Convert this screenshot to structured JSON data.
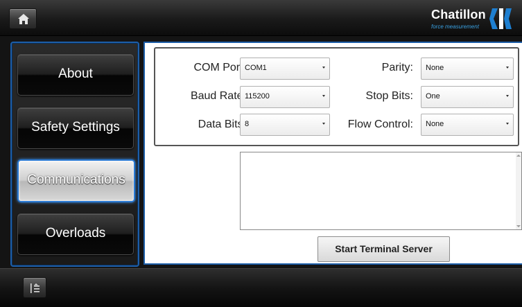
{
  "brand": {
    "name": "Chatillon",
    "tagline": "force measurement"
  },
  "icons": {
    "home": "home-icon",
    "menu": "list-toggle-icon",
    "logo": "chatillon-logo-mark"
  },
  "sidebar": {
    "items": [
      {
        "label": "About",
        "active": false
      },
      {
        "label": "Safety Settings",
        "active": false
      },
      {
        "label": "Communications",
        "active": true
      },
      {
        "label": "Overloads",
        "active": false
      }
    ]
  },
  "settings": {
    "com_port": {
      "label": "COM Port:",
      "value": "COM1"
    },
    "baud_rate": {
      "label": "Baud Rate:",
      "value": "115200"
    },
    "data_bits": {
      "label": "Data Bits:",
      "value": "8"
    },
    "parity": {
      "label": "Parity:",
      "value": "None"
    },
    "stop_bits": {
      "label": "Stop Bits:",
      "value": "One"
    },
    "flow_control": {
      "label": "Flow Control:",
      "value": "None"
    }
  },
  "terminal": {
    "content": ""
  },
  "actions": {
    "start_terminal_server": "Start Terminal Server"
  },
  "colors": {
    "accent": "#1d5ea8",
    "brand_blue": "#3aa0e0"
  }
}
